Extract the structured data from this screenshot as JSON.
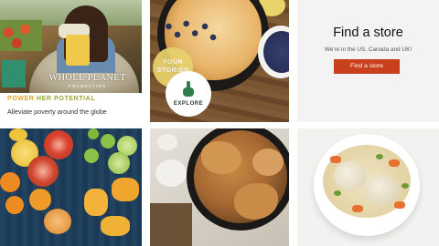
{
  "tile_foundation": {
    "logo_text": "WHOLE PLANET",
    "logo_sub": "FOUNDATION",
    "heading_power": "POWER",
    "heading_rest": "HER POTENTIAL",
    "body": "Alleviate poverty around the globe",
    "heading_color": "#e2a12a"
  },
  "tile_stories": {
    "badge_line1": "YOUR",
    "badge_line2": "STORIES",
    "explore_label": "EXPLORE",
    "icon": "touch-hand-icon"
  },
  "tile_store": {
    "title": "Find a store",
    "description": "We're in the US, Canada and UK!",
    "button_label": "Find a store",
    "button_color": "#c9401d"
  }
}
